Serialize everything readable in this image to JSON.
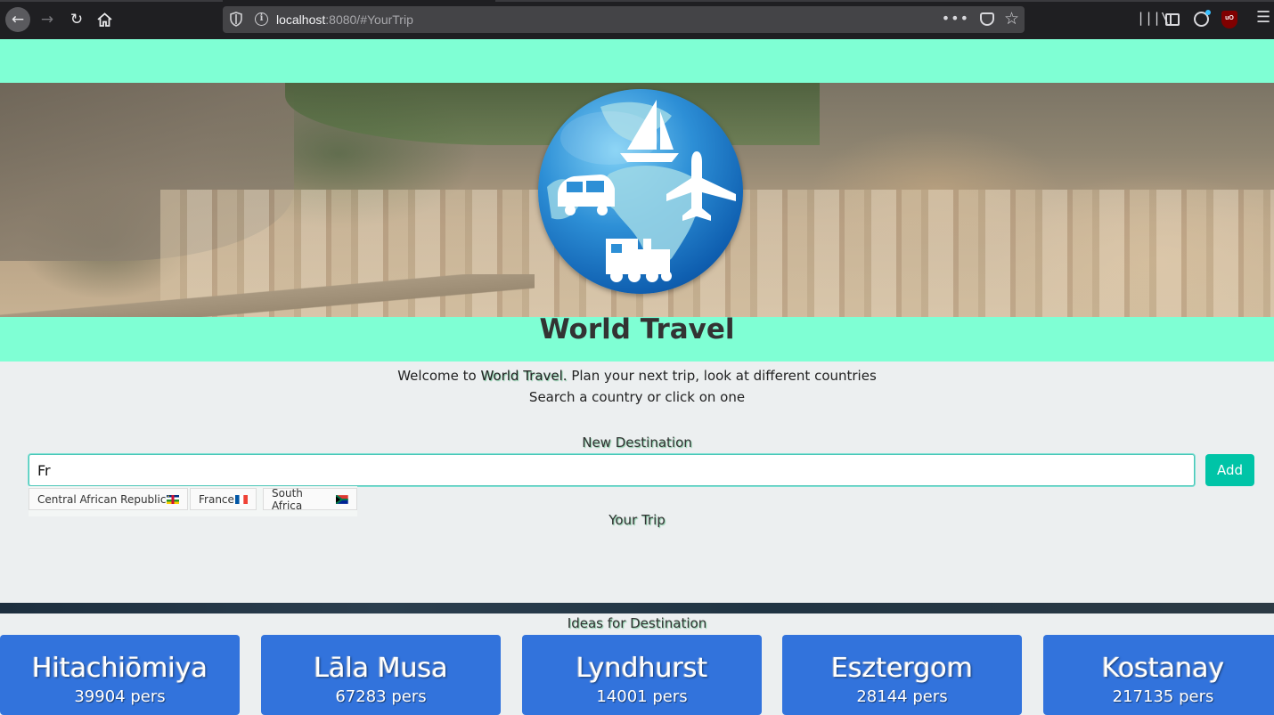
{
  "browser": {
    "url_host": "localhost",
    "url_rest": ":8080/#YourTrip",
    "icons": {
      "back": "arrow-left-icon",
      "forward": "arrow-right-icon",
      "reload": "reload-icon",
      "home": "home-icon",
      "shield": "tracking-shield-icon",
      "info": "site-info-icon",
      "more": "more-actions-icon",
      "pocket": "pocket-icon",
      "bookmark": "star-icon",
      "library": "library-icon",
      "sidebar": "sidebar-icon",
      "account": "account-icon",
      "ublock": "ublock-icon",
      "menu": "hamburger-menu-icon"
    },
    "ublock_label": "uO"
  },
  "site": {
    "title": "World Travel",
    "welcome_prefix": "Welcome to ",
    "welcome_brand": "World Travel.",
    "welcome_suffix": " Plan your next trip, look at different countries",
    "welcome_line2": "Search a country or click on one"
  },
  "destination_form": {
    "label": "New Destination",
    "input_value": "Fr",
    "add_label": "Add",
    "suggestions": [
      {
        "label": "Central African Republic",
        "flag": "central-african-republic-flag"
      },
      {
        "label": "France",
        "flag": "france-flag"
      },
      {
        "label": "South Africa",
        "flag": "south-africa-flag"
      }
    ]
  },
  "trip": {
    "label": "Your Trip"
  },
  "ideas": {
    "label": "Ideas for Destination",
    "cards": [
      {
        "name": "Hitachiōmiya",
        "population": "39904 pers"
      },
      {
        "name": "Lāla Musa",
        "population": "67283 pers"
      },
      {
        "name": "Lyndhurst",
        "population": "14001 pers"
      },
      {
        "name": "Esztergom",
        "population": "28144 pers"
      },
      {
        "name": "Kostanay",
        "population": "217135 pers"
      }
    ]
  },
  "colors": {
    "mint": "#7fffd4",
    "teal_button": "#00c4a7",
    "card_blue": "#3273dc"
  }
}
